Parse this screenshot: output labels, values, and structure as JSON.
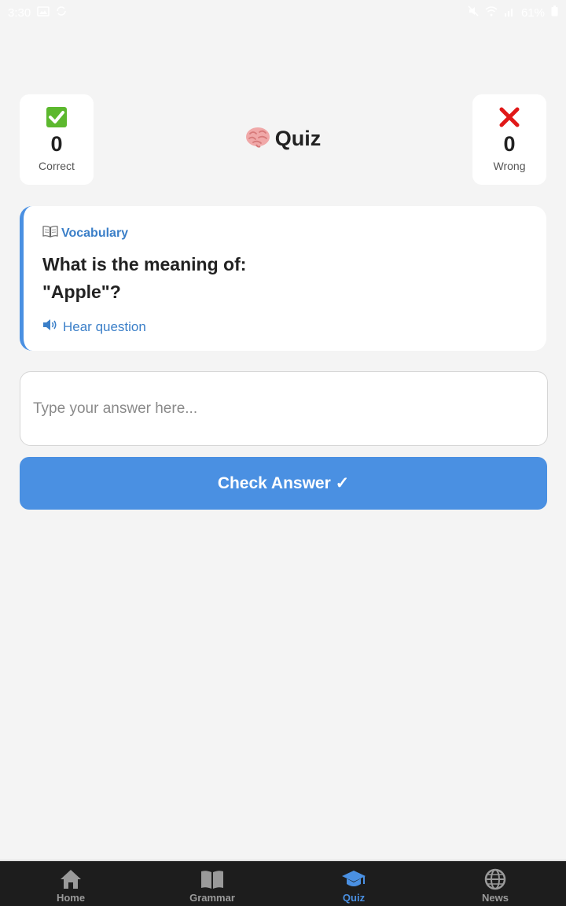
{
  "status_bar": {
    "time": "3:30",
    "battery": "61%"
  },
  "score": {
    "correct": {
      "value": "0",
      "label": "Correct"
    },
    "wrong": {
      "value": "0",
      "label": "Wrong"
    }
  },
  "title": "Quiz",
  "question": {
    "category": "Vocabulary",
    "line1": "What is the meaning of:",
    "line2": "\"Apple\"?",
    "hear_label": "Hear question"
  },
  "answer": {
    "placeholder": "Type your answer here...",
    "value": ""
  },
  "check_button": "Check Answer ✓",
  "nav": {
    "items": [
      {
        "label": "Home",
        "icon": "home-icon"
      },
      {
        "label": "Grammar",
        "icon": "book-icon"
      },
      {
        "label": "Quiz",
        "icon": "graduation-cap-icon",
        "active": true
      },
      {
        "label": "News",
        "icon": "globe-icon"
      }
    ]
  },
  "colors": {
    "accent": "#4a90e2",
    "background": "#f4f4f4",
    "nav_bg": "#1d1d1d"
  }
}
